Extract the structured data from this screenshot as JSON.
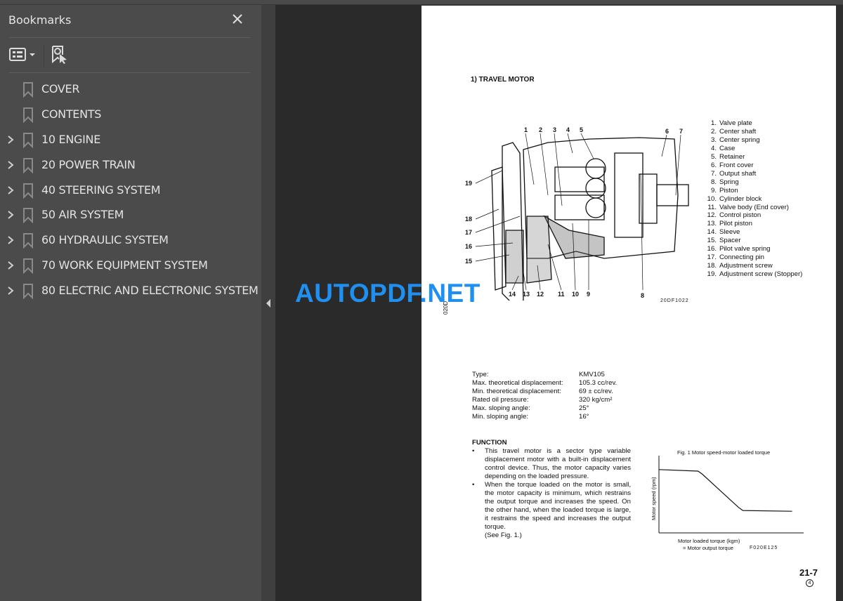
{
  "sidebar": {
    "title": "Bookmarks",
    "close_icon": "close-icon",
    "options_icon": "list-options-icon",
    "find_icon": "find-bookmark-icon",
    "items": [
      {
        "label": "COVER",
        "expandable": false
      },
      {
        "label": "CONTENTS",
        "expandable": false
      },
      {
        "label": "10 ENGINE",
        "expandable": true
      },
      {
        "label": "20 POWER TRAIN",
        "expandable": true
      },
      {
        "label": "40 STEERING SYSTEM",
        "expandable": true
      },
      {
        "label": "50 AIR SYSTEM",
        "expandable": true
      },
      {
        "label": "60 HYDRAULIC SYSTEM",
        "expandable": true
      },
      {
        "label": "70 WORK EQUIPMENT SYSTEM",
        "expandable": true
      },
      {
        "label": "80 ELECTRIC AND ELECTRONIC SYSTEM",
        "expandable": true
      }
    ]
  },
  "watermark": "AUTOPDF.NET",
  "document": {
    "heading": "1)   TRAVEL MOTOR",
    "diagram_callouts_top": [
      "1",
      "2",
      "3",
      "4",
      "5",
      "6",
      "7"
    ],
    "diagram_callouts_left": [
      "19",
      "18",
      "17",
      "16",
      "15"
    ],
    "diagram_callouts_bottom": [
      "14",
      "13",
      "12",
      "11",
      "10",
      "9",
      "8"
    ],
    "figure_code": "20DF1022",
    "side_code": "020D",
    "parts": [
      {
        "num": "1.",
        "name": "Valve plate"
      },
      {
        "num": "2.",
        "name": "Center shaft"
      },
      {
        "num": "3.",
        "name": "Center spring"
      },
      {
        "num": "4.",
        "name": "Case"
      },
      {
        "num": "5.",
        "name": "Retainer"
      },
      {
        "num": "6.",
        "name": "Front cover"
      },
      {
        "num": "7.",
        "name": "Output shaft"
      },
      {
        "num": "8.",
        "name": "Spring"
      },
      {
        "num": "9.",
        "name": "Piston"
      },
      {
        "num": "10.",
        "name": "Cylinder block"
      },
      {
        "num": "11.",
        "name": "Valve body (End cover)"
      },
      {
        "num": "12.",
        "name": "Control piston"
      },
      {
        "num": "13.",
        "name": "Pilot piston"
      },
      {
        "num": "14.",
        "name": "Sleeve"
      },
      {
        "num": "15.",
        "name": "Spacer"
      },
      {
        "num": "16.",
        "name": "Pilot valve spring"
      },
      {
        "num": "17.",
        "name": "Connecting pin"
      },
      {
        "num": "18.",
        "name": "Adjustment screw"
      },
      {
        "num": "19.",
        "name": "Adjustment screw (Stopper)"
      }
    ],
    "specs": [
      {
        "key": "Type:",
        "value": "KMV105"
      },
      {
        "key": "Max. theoretical displacement:",
        "value": "105.3 cc/rev."
      },
      {
        "key": "Min. theoretical displacement:",
        "value": "69 ± cc/rev."
      },
      {
        "key": "Rated oil pressure:",
        "value": "320 kg/cm²"
      },
      {
        "key": "Max. sloping angle:",
        "value": "25°"
      },
      {
        "key": "Min. sloping angle:",
        "value": "16°"
      }
    ],
    "function_title": "FUNCTION",
    "function_bullets": [
      "This travel motor is a sector type variable displacement motor with a built-in displacement control device. Thus, the motor capacity varies depending on the loaded pressure.",
      "When the torque loaded on the motor is small, the motor capacity is minimum, which restrains the output torque and increases the speed. On the other hand, when the loaded torque is large, it restrains the speed and increases the output torque."
    ],
    "bullet_char": "•",
    "see_fig": "(See Fig. 1.)",
    "figure_code_2": "F020E125",
    "page_number": "21-7",
    "revision": "4"
  },
  "chart_data": {
    "type": "line",
    "title": "Fig. 1  Motor speed-motor loaded torque",
    "xlabel": "Motor loaded torque (kgm)",
    "xlabel_2": "= Motor output torque",
    "ylabel": "Motor speed (rpm)",
    "x_ticks": [],
    "y_ticks": [],
    "grid": false,
    "note": "Qualitative curve; axes unlabeled numerically. Values normalized 0-1.",
    "xlim": [
      0,
      1
    ],
    "ylim": [
      0,
      1
    ],
    "series": [
      {
        "name": "Motor speed",
        "x": [
          0.0,
          0.27,
          0.3,
          0.55,
          0.58,
          0.92
        ],
        "y": [
          0.82,
          0.8,
          0.76,
          0.33,
          0.29,
          0.28
        ]
      }
    ]
  }
}
